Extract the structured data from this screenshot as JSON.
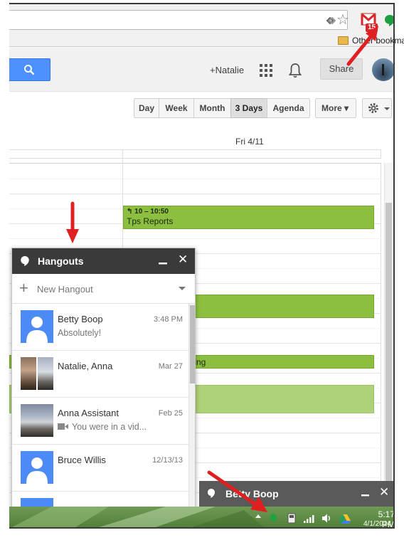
{
  "chrome": {
    "gmail_badge": "15",
    "bookmarks_folder": "Other bookmarks",
    "icons": [
      "extension-diamond-icon",
      "star-icon",
      "gmail-icon",
      "hangouts-extension-icon",
      "folder-icon"
    ]
  },
  "google_bar": {
    "plus_name": "+Natalie",
    "share_label": "Share",
    "icons": [
      "search-icon",
      "apps-grid-icon",
      "notifications-bell-icon"
    ]
  },
  "calendar": {
    "views": [
      "Day",
      "Week",
      "Month",
      "3 Days",
      "Agenda"
    ],
    "active_view": "3 Days",
    "more_label": "More ▾",
    "day_header": "Fri 4/11",
    "events": [
      {
        "time": "10 – 10:50",
        "title": "Tps Reports",
        "color": "#8cbf3f"
      },
      {
        "time": "",
        "title": "",
        "color": "#8cbf3f"
      },
      {
        "time": "",
        "title": "ining",
        "color": "#8cbf3f"
      },
      {
        "time": "",
        "title": "",
        "color": "#aed27a"
      }
    ]
  },
  "hangouts": {
    "title": "Hangouts",
    "new_hangout_label": "New Hangout",
    "conversations": [
      {
        "name": "Betty Boop",
        "time": "3:48 PM",
        "preview": "Absolutely!"
      },
      {
        "name": "Natalie, Anna",
        "time": "Mar 27",
        "preview": ""
      },
      {
        "name": "Anna Assistant",
        "time": "Feb 25",
        "preview": "You were in a vid..."
      },
      {
        "name": "Bruce Willis",
        "time": "12/13/13",
        "preview": ""
      }
    ]
  },
  "chat_tab": {
    "title": "Betty Boop"
  },
  "taskbar": {
    "clock_time": "5:17 PM",
    "clock_date": "4/1/2014"
  },
  "colors": {
    "event_green": "#8cbf3f",
    "hangouts_header": "#3a3a3a",
    "search_blue": "#4d90fe",
    "annotation_red": "#e02020"
  }
}
